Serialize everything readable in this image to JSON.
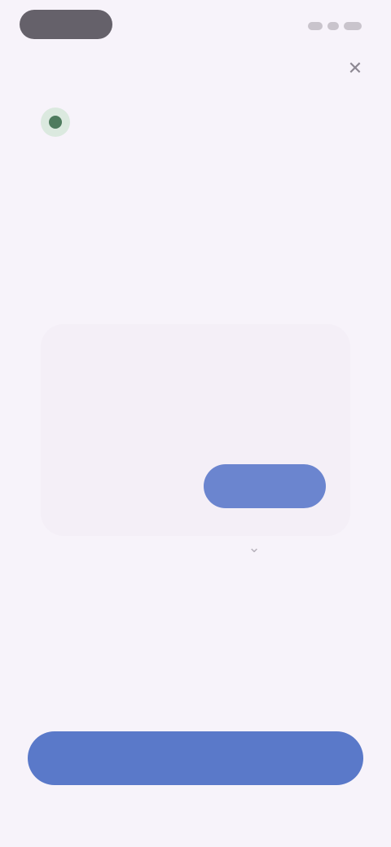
{
  "status_bar": {
    "indicator": "status-pill"
  },
  "header": {
    "title": "",
    "close_icon": "close-icon"
  },
  "info": {
    "icon": "check-circle-icon",
    "text": ""
  },
  "dialog": {
    "title": "",
    "body": "",
    "cancel_label": "",
    "confirm_label": ""
  },
  "primary_button": {
    "label": ""
  },
  "colors": {
    "background": "#f7f3fa",
    "accent": "#5a79c9",
    "dialog_accent": "#6b85cf",
    "info_icon": "#4e7b5e"
  }
}
